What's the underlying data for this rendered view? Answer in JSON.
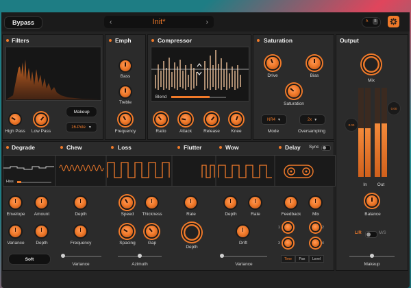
{
  "header": {
    "bypass_label": "Bypass",
    "preset_name": "Init*",
    "prev_arrow": "‹",
    "next_arrow": "›",
    "ab_a": "A",
    "ab_b": "B"
  },
  "accent_color": "#f07a2a",
  "filters": {
    "title": "Filters",
    "high_pass": "High Pass",
    "low_pass": "Low Pass",
    "makeup": "Makeup",
    "slope": "16-Pole"
  },
  "emph": {
    "title": "Emph",
    "bass": "Bass",
    "treble": "Treble",
    "frequency": "Frequency"
  },
  "compressor": {
    "title": "Compressor",
    "blend": "Blend",
    "ratio": "Ratio",
    "attack": "Attack",
    "release": "Release",
    "knee": "Knee"
  },
  "saturation": {
    "title": "Saturation",
    "drive": "Drive",
    "bias": "Bias",
    "saturation": "Saturation",
    "mode_value": "NR4",
    "mode": "Mode",
    "os_value": "2x",
    "oversampling": "Oversampling"
  },
  "output": {
    "title": "Output",
    "mix": "Mix",
    "in_readout": "0.00",
    "out_readout": "0.00",
    "in": "In",
    "out": "Out",
    "balance": "Balance",
    "lr": "L/R",
    "ms": "M/S",
    "makeup": "Makeup",
    "in_level": 0.55,
    "out_level": 0.6
  },
  "degrade": {
    "title": "Degrade",
    "hiss": "Hiss",
    "envelope": "Envelope",
    "amount": "Amount",
    "variance": "Variance",
    "depth": "Depth",
    "soft": "Soft"
  },
  "chew": {
    "title": "Chew",
    "depth": "Depth",
    "frequency": "Frequency",
    "variance": "Variance"
  },
  "loss": {
    "title": "Loss",
    "speed": "Speed",
    "thickness": "Thickness",
    "spacing": "Spacing",
    "gap": "Gap",
    "azimuth": "Azimuth"
  },
  "flutter": {
    "title": "Flutter",
    "rate": "Rate",
    "depth": "Depth"
  },
  "wow": {
    "title": "Wow",
    "depth": "Depth",
    "rate": "Rate",
    "drift": "Drift",
    "variance": "Variance"
  },
  "delay": {
    "title": "Delay",
    "sync": "Sync",
    "feedback": "Feedback",
    "mix": "Mix",
    "n1": "1",
    "n2": "2",
    "n3": "3",
    "n4": "4",
    "tab_time": "Time",
    "tab_pan": "Pan",
    "tab_level": "Level"
  }
}
